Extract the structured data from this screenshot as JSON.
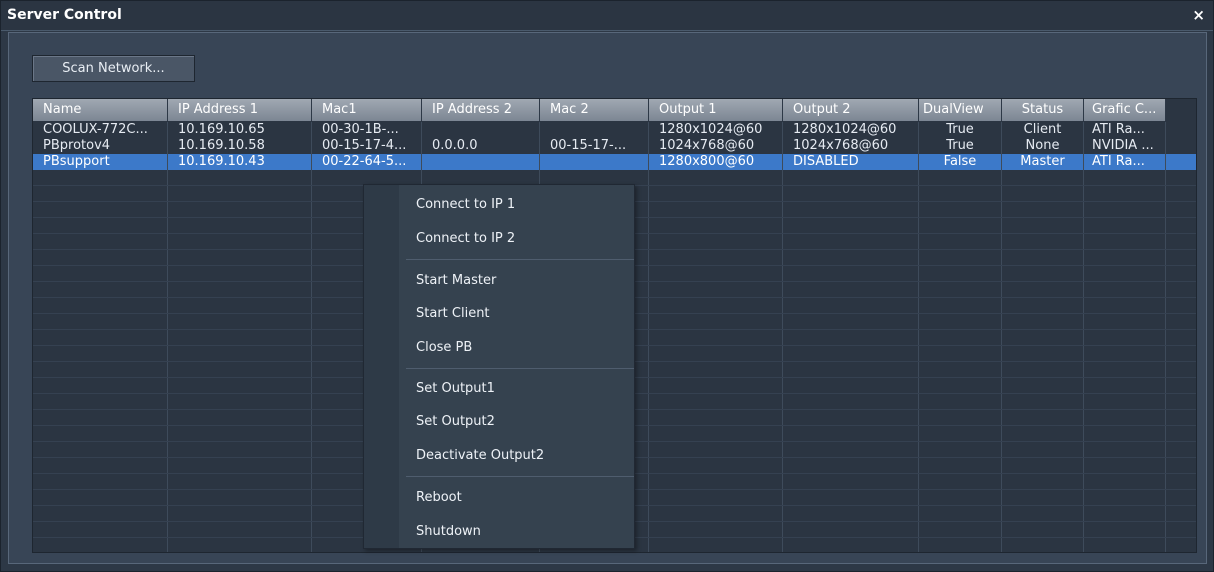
{
  "window": {
    "title": "Server Control",
    "close_glyph": "×"
  },
  "toolbar": {
    "scan_label": "Scan Network..."
  },
  "table": {
    "columns": [
      "Name",
      "IP Address 1",
      "Mac1",
      "IP Address 2",
      "Mac 2",
      "Output 1",
      "Output 2",
      "DualView",
      "Status",
      "Grafic C..."
    ],
    "rows": [
      [
        "COOLUX-772C...",
        "10.169.10.65",
        "00-30-1B-...",
        "",
        "",
        "1280x1024@60",
        "1280x1024@60",
        "True",
        "Client",
        "ATI Ra..."
      ],
      [
        "PBprotov4",
        "10.169.10.58",
        "00-15-17-4...",
        "0.0.0.0",
        "00-15-17-...",
        "1024x768@60",
        "1024x768@60",
        "True",
        "None",
        "NVIDIA ..."
      ],
      [
        "PBsupport",
        "10.169.10.43",
        "00-22-64-5...",
        "",
        "",
        "1280x800@60",
        "DISABLED",
        "False",
        "Master",
        "ATI Ra..."
      ]
    ]
  },
  "context_menu": {
    "items": [
      "Connect to IP 1",
      "Connect to IP 2",
      "Start Master",
      "Start Client",
      "Close PB",
      "Set Output1",
      "Set Output2",
      "Deactivate Output2",
      "Reboot",
      "Shutdown"
    ]
  },
  "colors": {
    "selection": "#3c79c9",
    "background": "#2d3846"
  }
}
